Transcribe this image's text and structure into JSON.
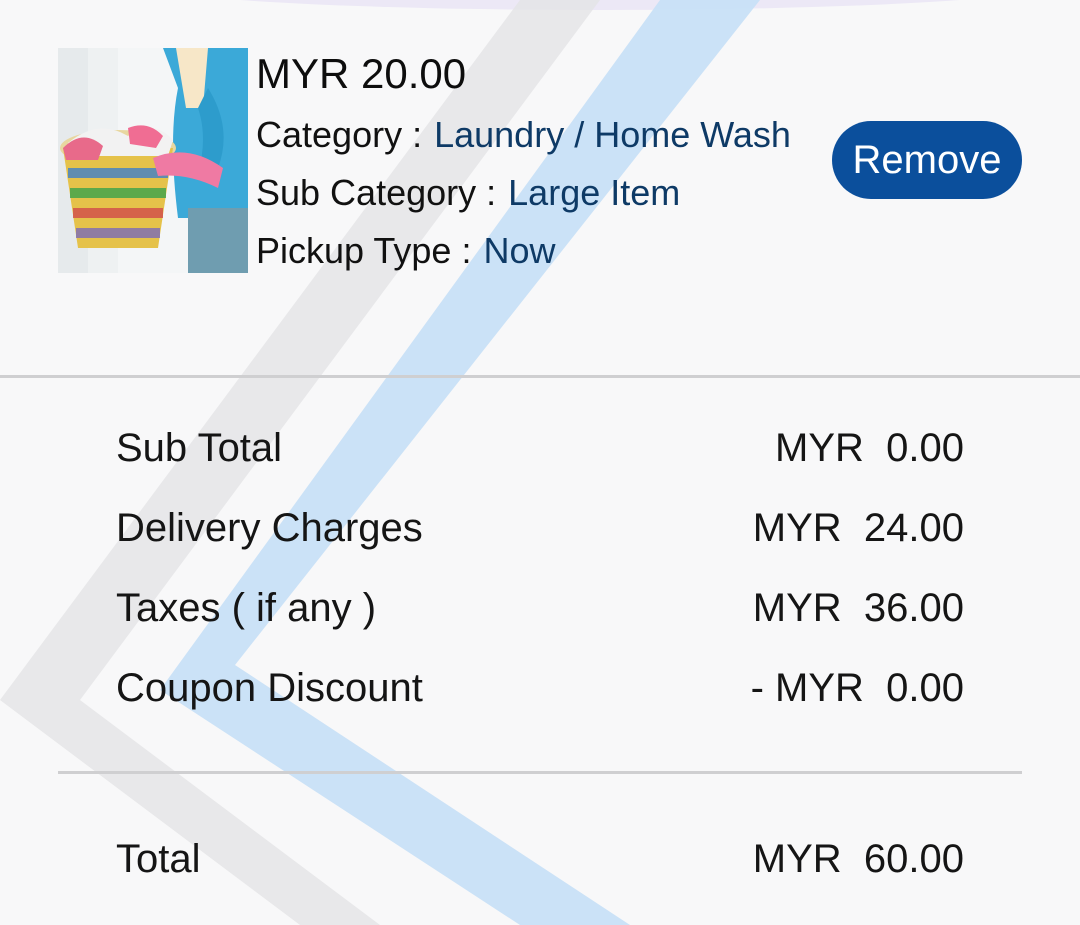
{
  "cart_item": {
    "price": "MYR 20.00",
    "category_label": "Category",
    "category_value": "Laundry / Home Wash",
    "subcategory_label": "Sub Category",
    "subcategory_value": "Large Item",
    "pickup_label": "Pickup Type",
    "pickup_value": "Now",
    "separator": ":",
    "remove_label": "Remove"
  },
  "summary": {
    "subtotal_label": "Sub Total",
    "subtotal_value": "MYR  0.00",
    "delivery_label": "Delivery Charges",
    "delivery_value": "MYR  24.00",
    "taxes_label": "Taxes ( if any )",
    "taxes_value": "MYR  36.00",
    "coupon_label": "Coupon Discount",
    "coupon_value": "- MYR  0.00",
    "total_label": "Total",
    "total_value": "MYR  60.00"
  },
  "colors": {
    "accent": "#0b4f9c",
    "value_text": "#0e3a66",
    "background": "#f8f8f9"
  }
}
